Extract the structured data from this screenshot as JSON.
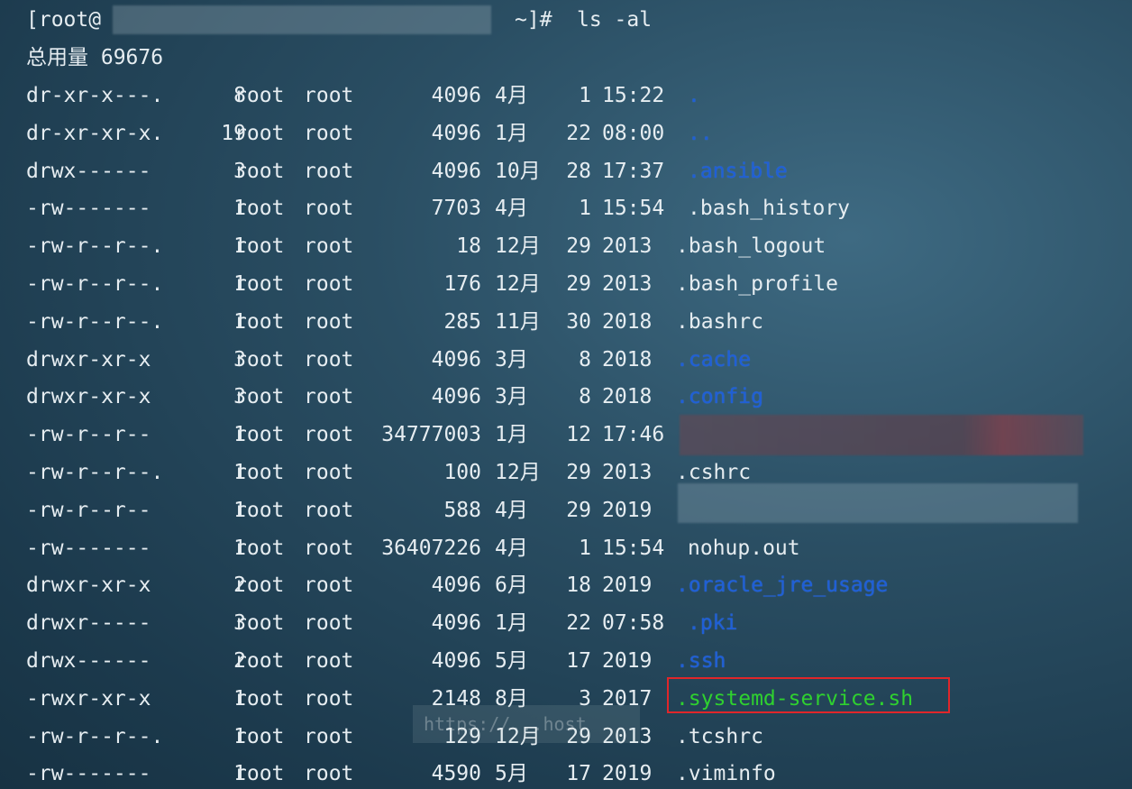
{
  "prompt": {
    "user_prefix": "[root@",
    "suffix": "~]#",
    "command": "ls -al"
  },
  "total": "总用量 69676",
  "rows": [
    {
      "perm": "dr-xr-x---.",
      "links": "8",
      "owner": "root",
      "group": "root",
      "size": "4096",
      "month": "4月",
      "day": "1",
      "time": "15:22",
      "name": ".",
      "kind": "dir"
    },
    {
      "perm": "dr-xr-xr-x.",
      "links": "19",
      "owner": "root",
      "group": "root",
      "size": "4096",
      "month": "1月",
      "day": "22",
      "time": "08:00",
      "name": "..",
      "kind": "dir"
    },
    {
      "perm": "drwx------",
      "links": "3",
      "owner": "root",
      "group": "root",
      "size": "4096",
      "month": "10月",
      "day": "28",
      "time": "17:37",
      "name": ".ansible",
      "kind": "dir"
    },
    {
      "perm": "-rw-------",
      "links": "1",
      "owner": "root",
      "group": "root",
      "size": "7703",
      "month": "4月",
      "day": "1",
      "time": "15:54",
      "name": ".bash_history",
      "kind": "file"
    },
    {
      "perm": "-rw-r--r--.",
      "links": "1",
      "owner": "root",
      "group": "root",
      "size": "18",
      "month": "12月",
      "day": "29",
      "time": "2013",
      "name": ".bash_logout",
      "kind": "file"
    },
    {
      "perm": "-rw-r--r--.",
      "links": "1",
      "owner": "root",
      "group": "root",
      "size": "176",
      "month": "12月",
      "day": "29",
      "time": "2013",
      "name": ".bash_profile",
      "kind": "file"
    },
    {
      "perm": "-rw-r--r--.",
      "links": "1",
      "owner": "root",
      "group": "root",
      "size": "285",
      "month": "11月",
      "day": "30",
      "time": "2018",
      "name": ".bashrc",
      "kind": "file"
    },
    {
      "perm": "drwxr-xr-x",
      "links": "3",
      "owner": "root",
      "group": "root",
      "size": "4096",
      "month": "3月",
      "day": "8",
      "time": "2018",
      "name": ".cache",
      "kind": "dir"
    },
    {
      "perm": "drwxr-xr-x",
      "links": "3",
      "owner": "root",
      "group": "root",
      "size": "4096",
      "month": "3月",
      "day": "8",
      "time": "2018",
      "name": ".config",
      "kind": "dir"
    },
    {
      "perm": "-rw-r--r--",
      "links": "1",
      "owner": "root",
      "group": "root",
      "size": "34777003",
      "month": "1月",
      "day": "12",
      "time": "17:46",
      "name": "",
      "kind": "redacted"
    },
    {
      "perm": "-rw-r--r--.",
      "links": "1",
      "owner": "root",
      "group": "root",
      "size": "100",
      "month": "12月",
      "day": "29",
      "time": "2013",
      "name": ".cshrc",
      "kind": "file"
    },
    {
      "perm": "-rw-r--r--",
      "links": "1",
      "owner": "root",
      "group": "root",
      "size": "588",
      "month": "4月",
      "day": "29",
      "time": "2019",
      "name": "",
      "kind": "redacted"
    },
    {
      "perm": "-rw-------",
      "links": "1",
      "owner": "root",
      "group": "root",
      "size": "36407226",
      "month": "4月",
      "day": "1",
      "time": "15:54",
      "name": "nohup.out",
      "kind": "file"
    },
    {
      "perm": "drwxr-xr-x",
      "links": "2",
      "owner": "root",
      "group": "root",
      "size": "4096",
      "month": "6月",
      "day": "18",
      "time": "2019",
      "name": ".oracle_jre_usage",
      "kind": "dir"
    },
    {
      "perm": "drwxr-----",
      "links": "3",
      "owner": "root",
      "group": "root",
      "size": "4096",
      "month": "1月",
      "day": "22",
      "time": "07:58",
      "name": ".pki",
      "kind": "dir"
    },
    {
      "perm": "drwx------",
      "links": "2",
      "owner": "root",
      "group": "root",
      "size": "4096",
      "month": "5月",
      "day": "17",
      "time": "2019",
      "name": ".ssh",
      "kind": "dir"
    },
    {
      "perm": "-rwxr-xr-x",
      "links": "1",
      "owner": "root",
      "group": "root",
      "size": "2148",
      "month": "8月",
      "day": "3",
      "time": "2017",
      "name": ".systemd-service.sh",
      "kind": "exec"
    },
    {
      "perm": "-rw-r--r--.",
      "links": "1",
      "owner": "root",
      "group": "root",
      "size": "129",
      "month": "12月",
      "day": "29",
      "time": "2013",
      "name": ".tcshrc",
      "kind": "file"
    },
    {
      "perm": "-rw-------",
      "links": "1",
      "owner": "root",
      "group": "root",
      "size": "4590",
      "month": "5月",
      "day": "17",
      "time": "2019",
      "name": ".viminfo",
      "kind": "file"
    }
  ],
  "colors": {
    "directory": "#1f5fd6",
    "executable": "#2fd12f",
    "highlight_border": "#e0262a",
    "text": "#e6edf1"
  },
  "watermark": "https://...host"
}
